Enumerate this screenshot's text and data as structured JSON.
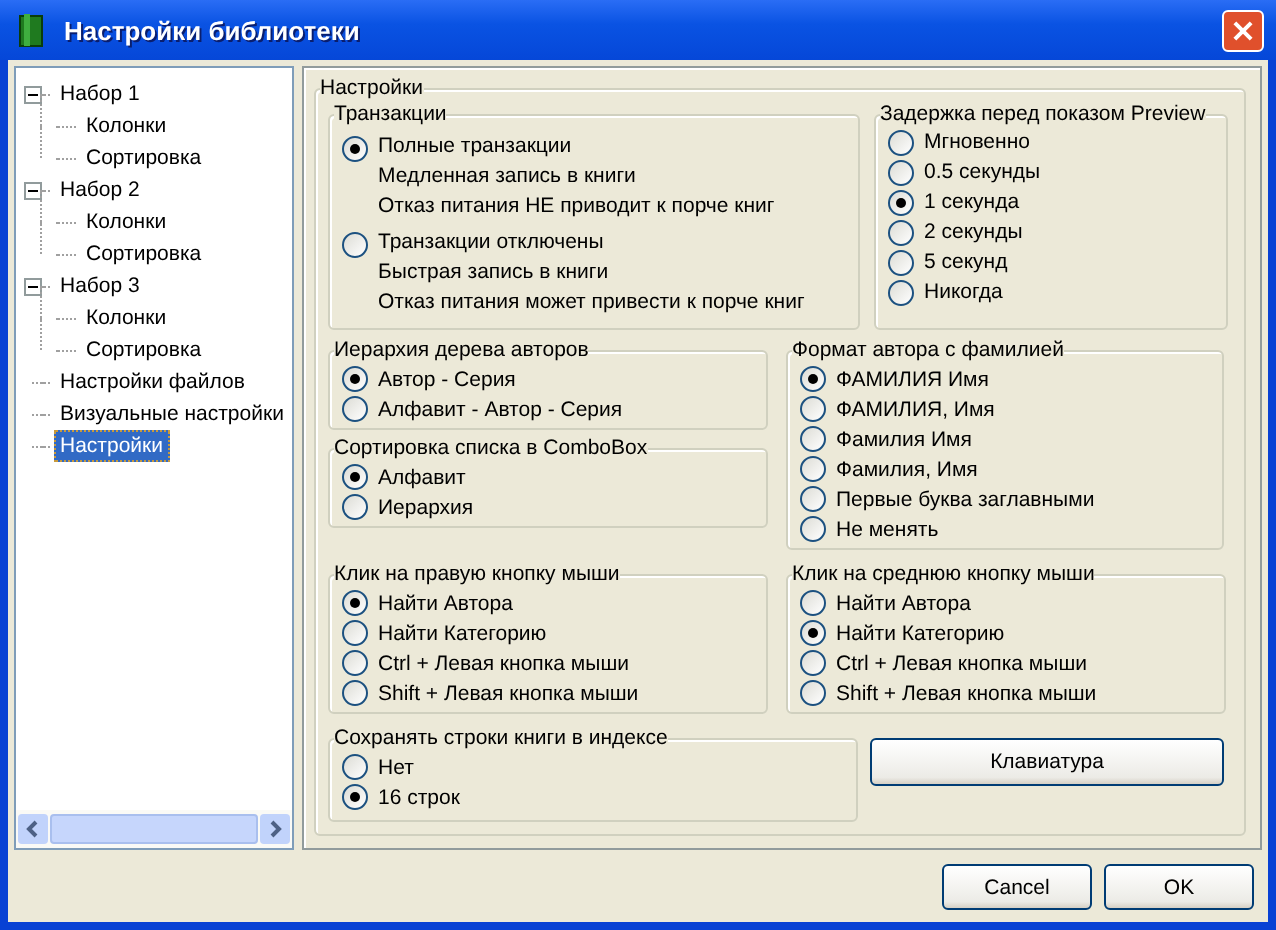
{
  "window": {
    "title": "Настройки библиотеки"
  },
  "tree": [
    {
      "label": "Набор 1",
      "expanded": true,
      "selected": false,
      "children": [
        {
          "label": "Колонки",
          "selected": false
        },
        {
          "label": "Сортировка",
          "selected": false
        }
      ]
    },
    {
      "label": "Набор 2",
      "expanded": true,
      "selected": false,
      "children": [
        {
          "label": "Колонки",
          "selected": false
        },
        {
          "label": "Сортировка",
          "selected": false
        }
      ]
    },
    {
      "label": "Набор 3",
      "expanded": true,
      "selected": false,
      "children": [
        {
          "label": "Колонки",
          "selected": false
        },
        {
          "label": "Сортировка",
          "selected": false
        }
      ]
    },
    {
      "label": "Настройки файлов",
      "selected": false
    },
    {
      "label": "Визуальные настройки",
      "selected": false
    },
    {
      "label": "Настройки",
      "selected": true
    }
  ],
  "settings": {
    "title": "Настройки",
    "groups": [
      {
        "title": "Транзакции",
        "options": [
          {
            "label": "Полные транзакции",
            "details": [
              "Медленная запись в книги",
              "Отказ питания НЕ приводит к порче книг"
            ],
            "selected": true
          },
          {
            "label": "Транзакции отключены",
            "details": [
              "Быстрая запись в книги",
              "Отказ питания может привести к порче книг"
            ],
            "selected": false
          }
        ]
      },
      {
        "title": "Задержка перед показом Preview",
        "options": [
          {
            "label": "Мгновенно",
            "selected": false
          },
          {
            "label": "0.5 секунды",
            "selected": false
          },
          {
            "label": "1 секунда",
            "selected": true
          },
          {
            "label": "2 секунды",
            "selected": false
          },
          {
            "label": "5 секунд",
            "selected": false
          },
          {
            "label": "Никогда",
            "selected": false
          }
        ]
      },
      {
        "title": "Иерархия дерева авторов",
        "options": [
          {
            "label": "Автор - Серия",
            "selected": true
          },
          {
            "label": "Алфавит - Автор - Серия",
            "selected": false
          }
        ]
      },
      {
        "title": "Сортировка списка в ComboBox",
        "options": [
          {
            "label": "Алфавит",
            "selected": true
          },
          {
            "label": "Иерархия",
            "selected": false
          }
        ]
      },
      {
        "title": "Формат автора с фамилией",
        "options": [
          {
            "label": "ФАМИЛИЯ Имя",
            "selected": true
          },
          {
            "label": "ФАМИЛИЯ, Имя",
            "selected": false
          },
          {
            "label": "Фамилия Имя",
            "selected": false
          },
          {
            "label": "Фамилия, Имя",
            "selected": false
          },
          {
            "label": "Первые буква заглавными",
            "selected": false
          },
          {
            "label": "Не менять",
            "selected": false
          }
        ]
      },
      {
        "title": "Клик на правую кнопку мыши",
        "options": [
          {
            "label": "Найти Автора",
            "selected": true
          },
          {
            "label": "Найти Категорию",
            "selected": false
          },
          {
            "label": "Ctrl + Левая кнопка мыши",
            "selected": false
          },
          {
            "label": "Shift + Левая кнопка мыши",
            "selected": false
          }
        ]
      },
      {
        "title": "Клик на среднюю кнопку мыши",
        "options": [
          {
            "label": "Найти Автора",
            "selected": false
          },
          {
            "label": "Найти Категорию",
            "selected": true
          },
          {
            "label": "Ctrl + Левая кнопка мыши",
            "selected": false
          },
          {
            "label": "Shift + Левая кнопка мыши",
            "selected": false
          }
        ]
      },
      {
        "title": "Сохранять строки книги в индексе",
        "options": [
          {
            "label": "Нет",
            "selected": false
          },
          {
            "label": "16 строк",
            "selected": true
          }
        ]
      }
    ],
    "keyboard_button": "Клавиатура"
  },
  "buttons": [
    "Cancel",
    "OK"
  ]
}
